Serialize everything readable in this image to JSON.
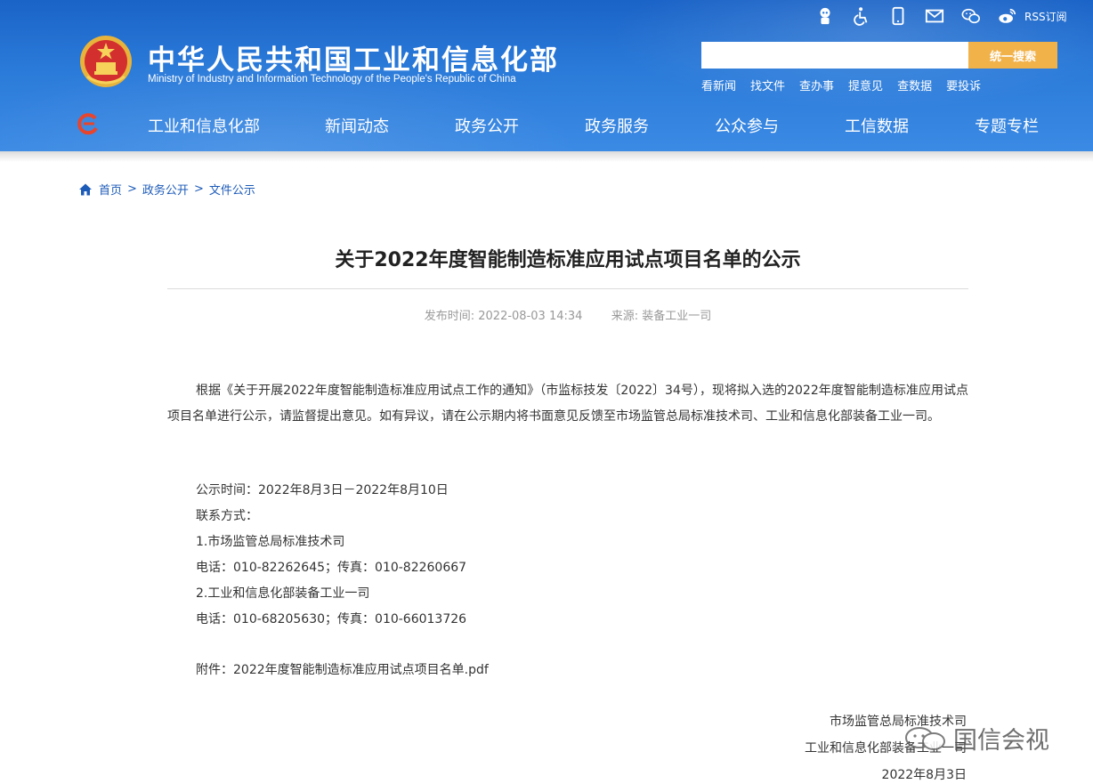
{
  "header": {
    "title_cn": "中华人民共和国工业和信息化部",
    "title_en": "Ministry of Industry and Information Technology of the People's Republic of China",
    "rss_label": "RSS订阅",
    "search_placeholder": "",
    "search_button": "统一搜索",
    "quick_links": [
      "看新闻",
      "找文件",
      "查办事",
      "提意见",
      "查数据",
      "要投诉"
    ],
    "nav": [
      "工业和信息化部",
      "新闻动态",
      "政务公开",
      "政务服务",
      "公众参与",
      "工信数据",
      "专题专栏"
    ],
    "icons": [
      "robot-assistant-icon",
      "accessibility-icon",
      "mobile-icon",
      "mail-icon",
      "wechat-icon",
      "weibo-icon"
    ]
  },
  "breadcrumb": [
    "首页",
    "政务公开",
    "文件公示"
  ],
  "article": {
    "title": "关于2022年度智能制造标准应用试点项目名单的公示",
    "publish_label": "发布时间:",
    "publish_time": "2022-08-03 14:34",
    "source_label": "来源:",
    "source": "装备工业一司",
    "intro": "根据《关于开展2022年度智能制造标准应用试点工作的通知》（市监标技发〔2022〕34号），现将拟入选的2022年度智能制造标准应用试点项目名单进行公示，请监督提出意见。如有异议，请在公示期内将书面意见反馈至市场监管总局标准技术司、工业和信息化部装备工业一司。",
    "period": "公示时间：2022年8月3日－2022年8月10日",
    "contact_label": "联系方式：",
    "contact1_name": "1.市场监管总局标准技术司",
    "contact1_phone": "电话：010-82262645；传真：010-82260667",
    "contact2_name": "2.工业和信息化部装备工业一司",
    "contact2_phone": "电话：010-68205630；传真：010-66013726",
    "attachment": "附件：2022年度智能制造标准应用试点项目名单.pdf",
    "sign1": "市场监管总局标准技术司",
    "sign2": "工业和信息化部装备工业一司",
    "sign_date": "2022年8月3日"
  },
  "watermark": "国信会视",
  "colors": {
    "header_blue": "#2a7ad9",
    "search_button": "#f2b24a",
    "link_blue": "#1d5bb8"
  }
}
